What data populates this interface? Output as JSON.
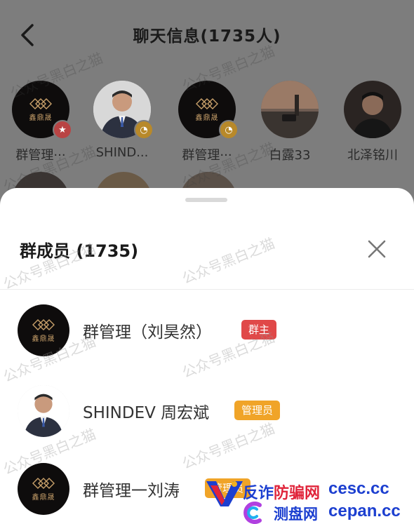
{
  "header": {
    "title": "聊天信息(1735人)"
  },
  "grid": {
    "members": [
      {
        "name": "群管理···",
        "avatar": "logo",
        "role": "owner",
        "role_icon": "star-icon"
      },
      {
        "name": "SHIND...",
        "avatar": "person",
        "role": "admin",
        "role_icon": "admin-icon"
      },
      {
        "name": "群管理···",
        "avatar": "logo",
        "role": "admin",
        "role_icon": "admin-icon"
      },
      {
        "name": "白露33",
        "avatar": "street-photo",
        "role": "",
        "role_icon": ""
      },
      {
        "name": "北泽铭川",
        "avatar": "person-dark",
        "role": "",
        "role_icon": ""
      }
    ]
  },
  "sheet": {
    "title": "群成员 (1735)",
    "close_icon": "close-icon",
    "members": [
      {
        "name": "群管理（刘昊然）",
        "avatar": "logo",
        "badge": "群主"
      },
      {
        "name": "SHINDEV 周宏斌",
        "avatar": "person",
        "badge": "管理员"
      },
      {
        "name": "群管理一刘涛",
        "avatar": "logo",
        "badge": "管理员"
      }
    ]
  },
  "watermark": "公众号黑白之猫",
  "logo_text": "鑫鼎晟",
  "promo": {
    "line1_prefix": "反诈",
    "line1_highlight": "防骗网",
    "line1_domain": "cesc.cc",
    "line2": "测盘网",
    "line2_domain": "cepan.cc"
  },
  "colors": {
    "owner_badge": "#e04848",
    "admin_badge": "#f0a428",
    "promo_blue": "#1c3fd0",
    "promo_red": "#e0243a"
  }
}
